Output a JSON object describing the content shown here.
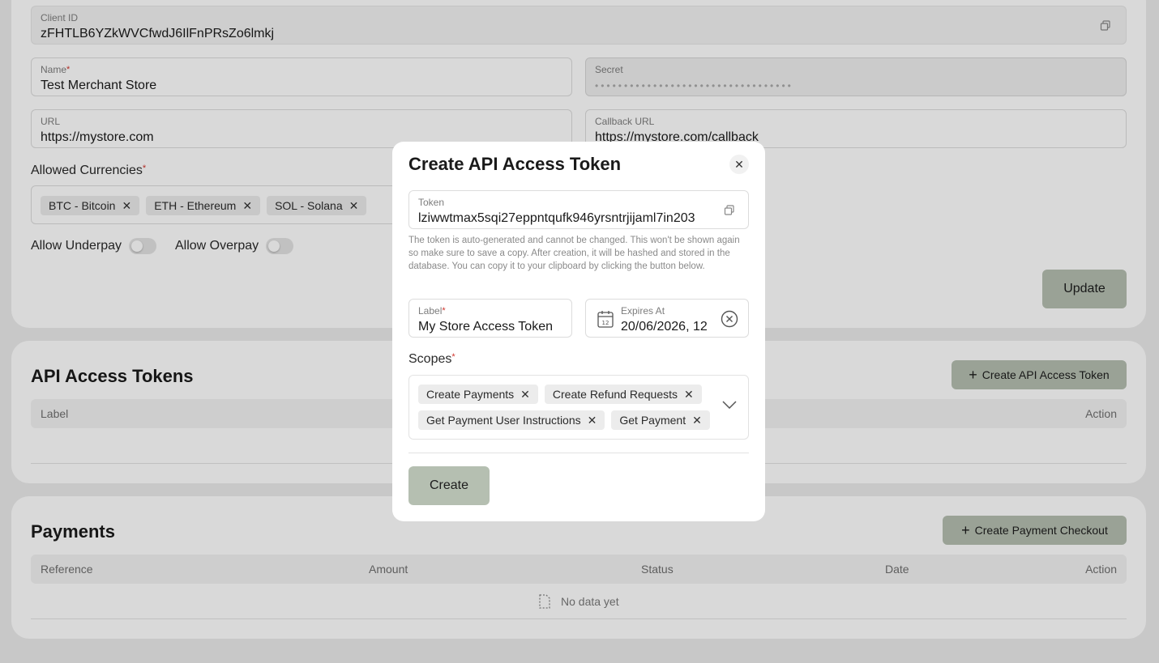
{
  "merchant": {
    "client_id_label": "Client ID",
    "client_id_value": "zFHTLB6YZkWVCfwdJ6IlFnPRsZo6lmkj",
    "name_label": "Name",
    "name_value": "Test Merchant Store",
    "secret_label": "Secret",
    "secret_value": "••••••••••••••••••••••••••••••••••",
    "url_label": "URL",
    "url_value": "https://mystore.com",
    "callback_label": "Callback URL",
    "callback_value": "https://mystore.com/callback",
    "currencies_label": "Allowed Currencies",
    "currencies": [
      "BTC - Bitcoin",
      "ETH - Ethereum",
      "SOL - Solana"
    ],
    "underpay_label": "Allow Underpay",
    "overpay_label": "Allow Overpay",
    "update_label": "Update"
  },
  "tokens": {
    "title": "API Access Tokens",
    "create_label": "Create API Access Token",
    "columns": [
      "Label",
      "Action"
    ]
  },
  "payments": {
    "title": "Payments",
    "create_label": "Create Payment Checkout",
    "columns": [
      "Reference",
      "Amount",
      "Status",
      "Date",
      "Action"
    ],
    "empty_text": "No data yet"
  },
  "modal": {
    "title": "Create API Access Token",
    "token_label": "Token",
    "token_value": "lziwwtmax5sqi27eppntqufk946yrsntrjijaml7in203",
    "helper_text": "The token is auto-generated and cannot be changed. This won't be shown again so make sure to save a copy. After creation, it will be hashed and stored in the database. You can copy it to your clipboard by clicking the button below.",
    "label_label": "Label",
    "label_value": "My Store Access Token",
    "expires_label": "Expires At",
    "expires_value": "20/06/2026, 12",
    "scopes_label": "Scopes",
    "scopes": [
      "Create Payments",
      "Create Refund Requests",
      "Get Payment User Instructions",
      "Get Payment"
    ],
    "create_label": "Create"
  },
  "colors": {
    "accent": "#b5bfb1",
    "required": "#d0342c"
  }
}
